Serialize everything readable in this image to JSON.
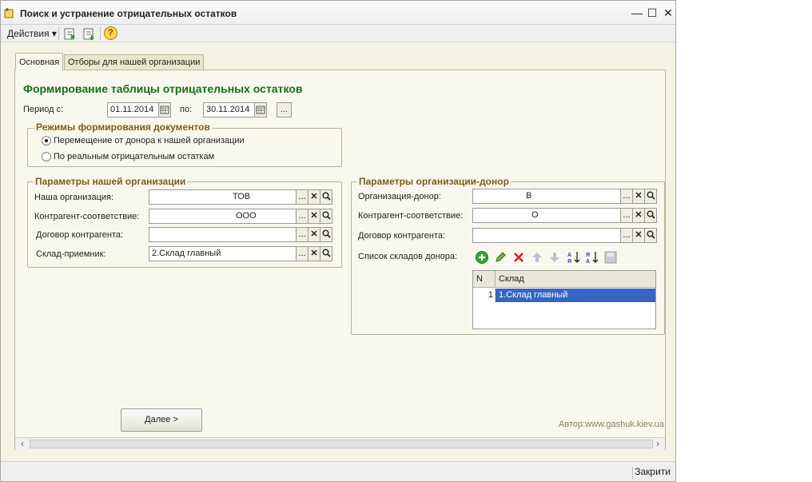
{
  "window": {
    "title": "Поиск и устранение отрицательных остатков",
    "minimize": "—",
    "maximize": "☐",
    "close": "✕"
  },
  "toolbar": {
    "actions_label": "Действия ▾",
    "help": "?"
  },
  "tabs": [
    {
      "label": "Основная"
    },
    {
      "label": "Отборы для нашей организации"
    }
  ],
  "main": {
    "heading": "Формирование таблицы отрицательных остатков",
    "period_from_label": "Период с:",
    "period_from": "01.11.2014",
    "period_to_label": "по:",
    "period_to": "30.11.2014",
    "period_btn": "..."
  },
  "modes": {
    "title": "Режимы формирования документов",
    "options": [
      {
        "label": "Перемещение от донора к нашей организации",
        "selected": true
      },
      {
        "label": "По реальным отрицательным остаткам",
        "selected": false
      }
    ]
  },
  "our_org": {
    "title": "Параметры нашей организации",
    "fields": [
      {
        "label": "Наша организация:",
        "value": "ТОВ"
      },
      {
        "label": "Контрагент-соответствие:",
        "value": "ООО"
      },
      {
        "label": "Договор контрагента:",
        "value": ""
      },
      {
        "label": "Склад-приемник:",
        "value": "2.Склад главный"
      }
    ]
  },
  "donor_org": {
    "title": "Параметры организации-донор",
    "fields": [
      {
        "label": "Организация-донор:",
        "value": "В"
      },
      {
        "label": "Контрагент-соответствие:",
        "value": "О"
      },
      {
        "label": "Договор контрагента:",
        "value": ""
      }
    ],
    "warehouses_label": "Список складов донора:",
    "grid": {
      "col_n": "N",
      "col_sklad": "Склад",
      "rows": [
        {
          "n": "1",
          "sklad": "1.Склад главный"
        }
      ]
    }
  },
  "buttons": {
    "next": "Далее >",
    "select": "...",
    "clear": "✕"
  },
  "author": "Автор:www.gashuk.kiev.ua",
  "statusbar": {
    "close_label": "Закрити"
  },
  "colors": {
    "heading": "#1a6c1a",
    "group_title": "#7a5e1a",
    "selected_row": "#3a63c4"
  }
}
